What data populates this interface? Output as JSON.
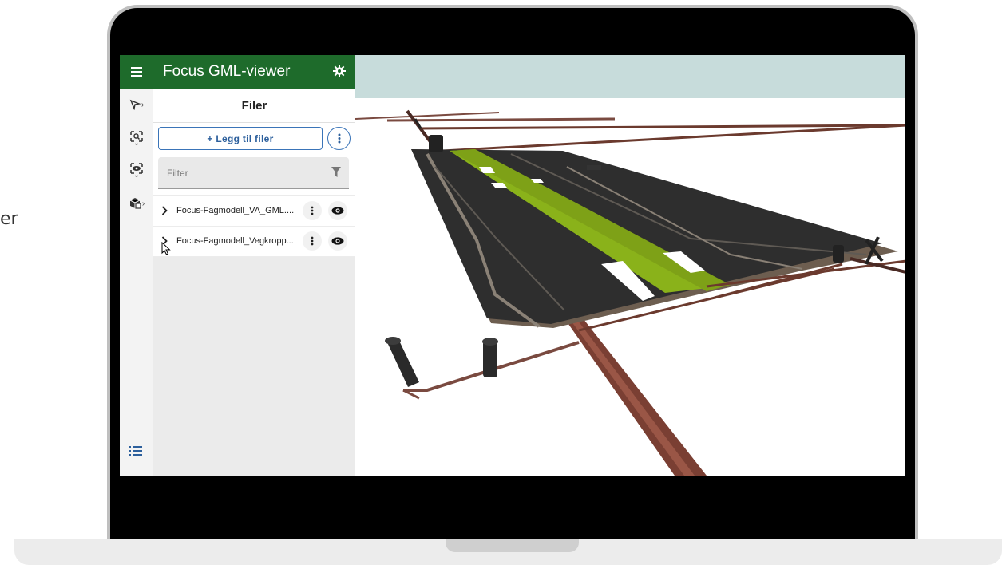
{
  "side_text": "er",
  "app": {
    "title": "Focus GML-viewer"
  },
  "panel": {
    "heading": "Filer",
    "add_button": "+ Legg til filer",
    "filter_placeholder": "Filter"
  },
  "files": [
    {
      "name": "Focus-Fagmodell_VA_GML...."
    },
    {
      "name": "Focus-Fagmodell_Vegkropp..."
    }
  ],
  "colors": {
    "header_green": "#1e6b2b",
    "accent_blue": "#3a74b8",
    "road_dark": "#2e2e2e",
    "median_green": "#8ab21a",
    "pipe_brown": "#6b3a2e",
    "sky": "#c7dcdb"
  },
  "icons": {
    "menu": "hamburger-menu-icon",
    "settings": "gear-icon",
    "select": "select-cursor-icon",
    "zoom": "zoom-extent-icon",
    "view": "view-eye-icon",
    "objects": "cube-objects-icon",
    "more": "more-vert-icon",
    "visibility": "eye-icon",
    "filter": "filter-funnel-icon",
    "list": "list-icon"
  }
}
